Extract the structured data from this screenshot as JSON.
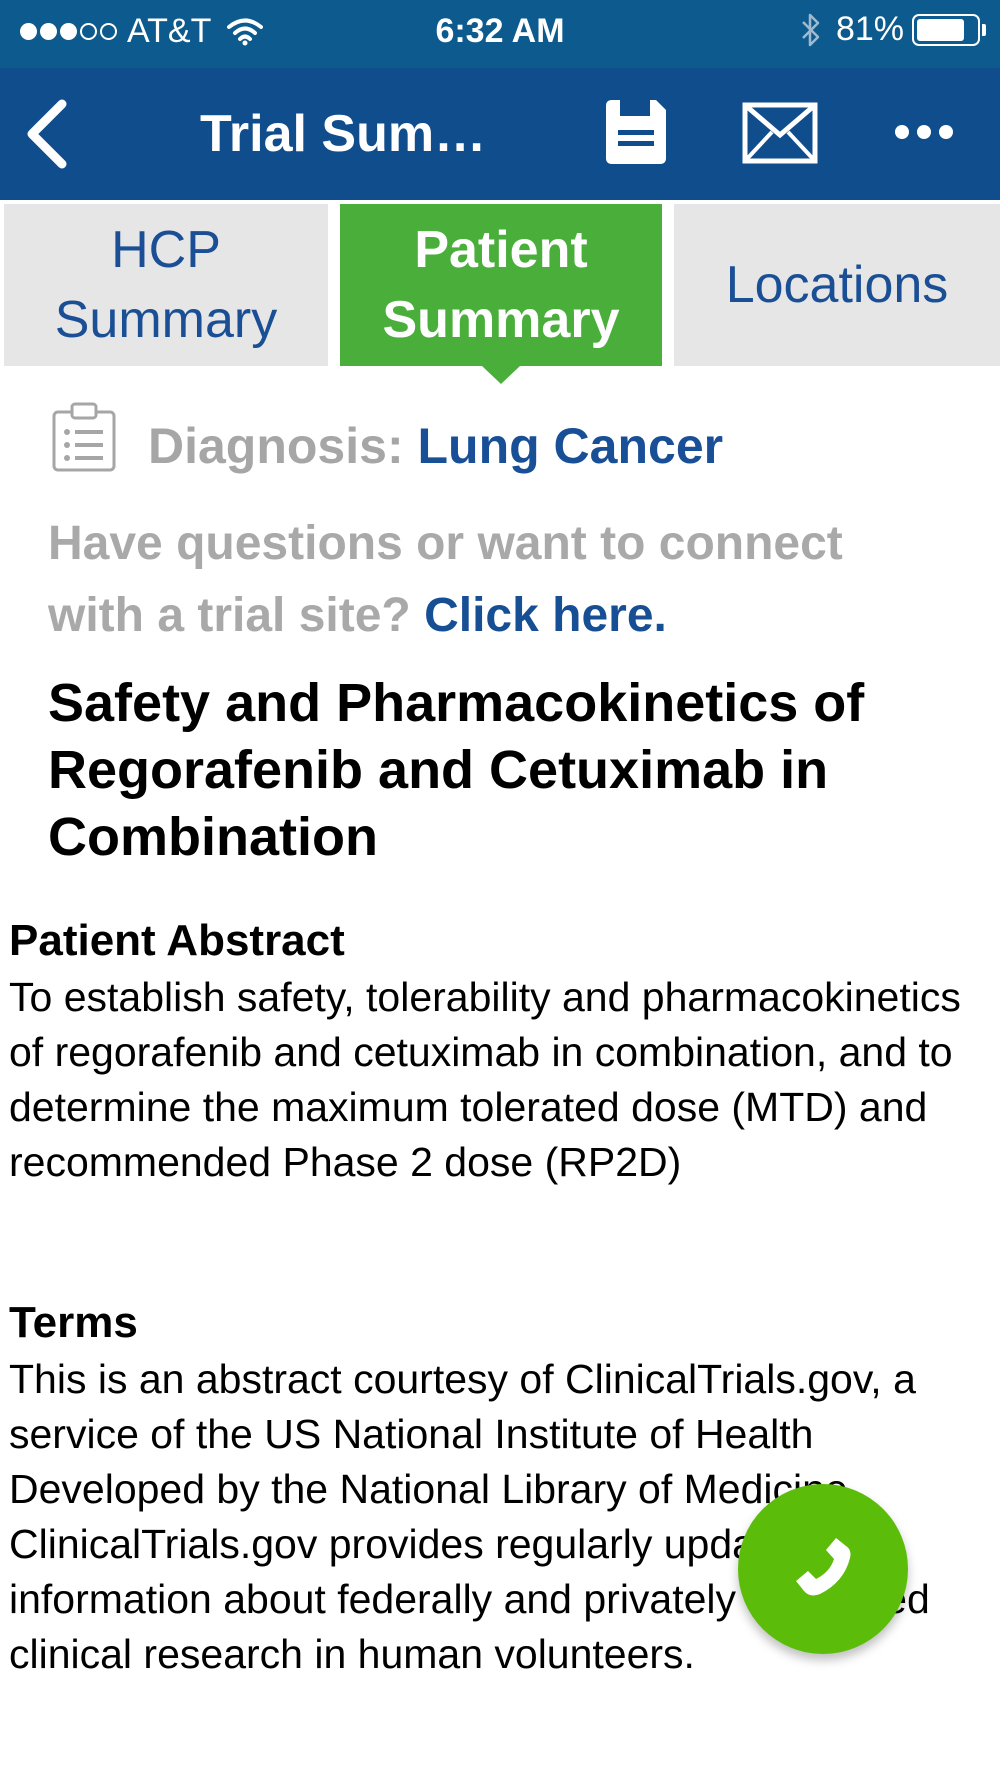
{
  "status_bar": {
    "carrier": "AT&T",
    "time": "6:32 AM",
    "battery": "81%",
    "signal_bars": 3,
    "signal_total": 5,
    "battery_level": 0.81
  },
  "nav": {
    "title": "Trial Summary",
    "back_icon": "chevron-left-icon",
    "save_icon": "save-icon",
    "mail_icon": "mail-icon",
    "more_icon": "more-icon"
  },
  "tabs": [
    {
      "line1": "HCP",
      "line2": "Summary",
      "active": false
    },
    {
      "line1": "Patient",
      "line2": "Summary",
      "active": true
    },
    {
      "label": "Locations",
      "active": false
    }
  ],
  "diagnosis": {
    "label": "Diagnosis:",
    "value": "Lung Cancer",
    "icon": "clipboard-icon"
  },
  "questions": {
    "text": "Have questions or want to connect with a trial site?",
    "link": "Click here."
  },
  "trial_title": "Safety and Pharmacokinetics of Regorafenib and Cetuximab in Combination",
  "abstract": {
    "heading": "Patient Abstract",
    "body": "To establish safety, tolerability and pharmacokinetics of regorafenib and cetuximab in combination, and to determine the maximum tolerated dose (MTD) and recommended Phase 2 dose (RP2D)"
  },
  "terms": {
    "heading": "Terms",
    "body": "This is an abstract courtesy of ClinicalTrials.gov, a service of the US National Institute of Health Developed by the National Library of Medicine. ClinicalTrials.gov provides regularly updated information about federally and privately supported clinical research in human volunteers."
  },
  "call_button": {
    "icon": "phone-icon"
  },
  "colors": {
    "status_bar": "#0d5b8e",
    "nav_bar": "#0f4d8d",
    "active_tab": "#4aae3b",
    "inactive_tab": "#e6e6e6",
    "link": "#174f95",
    "call_button": "#5bbd0a"
  }
}
